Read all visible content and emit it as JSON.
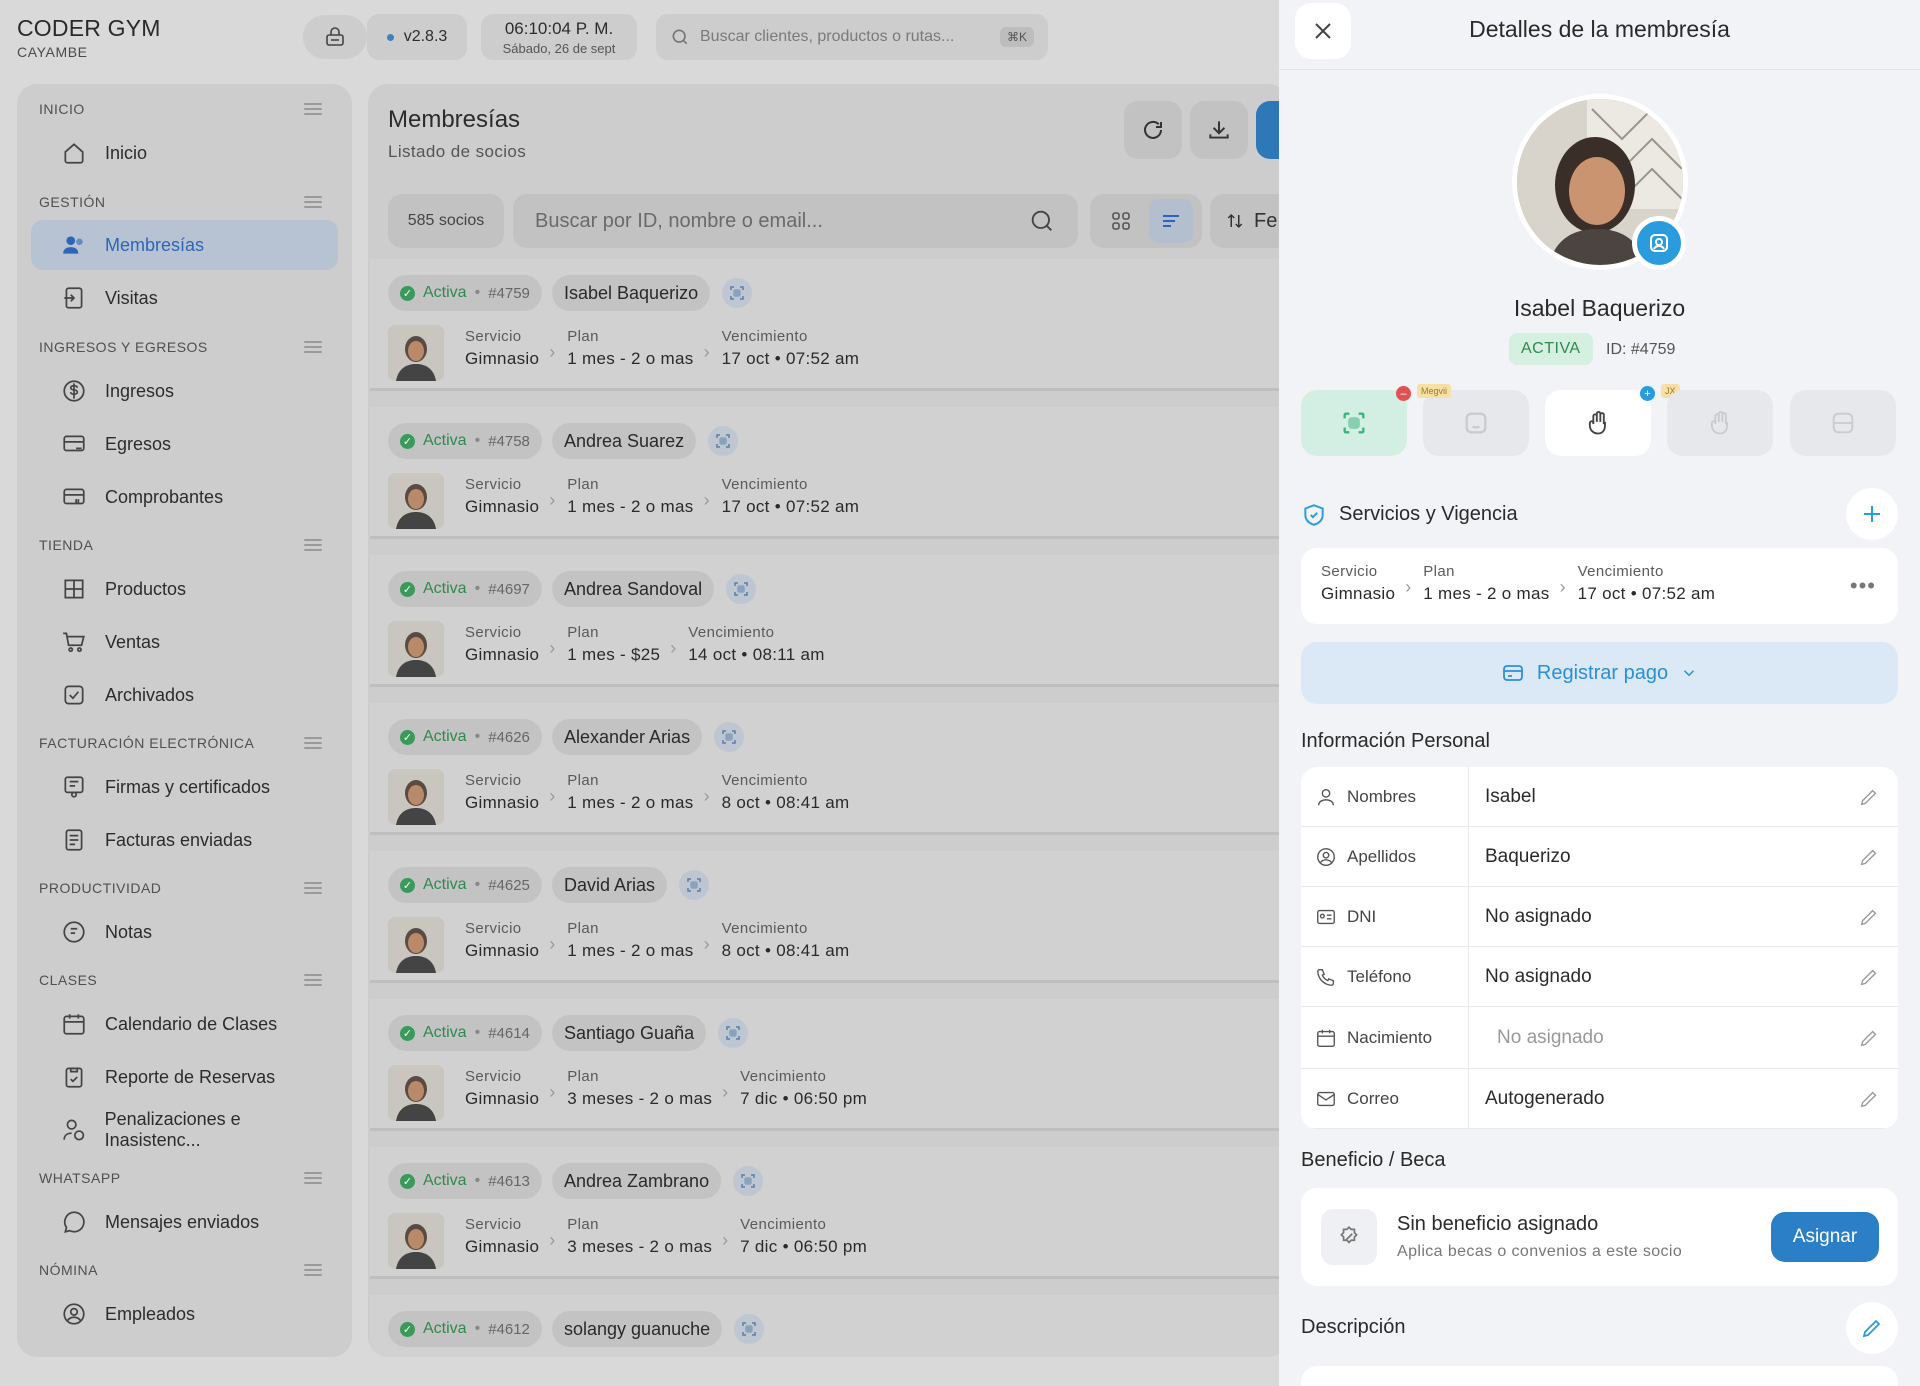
{
  "brand": {
    "title": "CODER GYM",
    "subtitle": "CAYAMBE"
  },
  "topbar": {
    "version": "v2.8.3",
    "time": "06:10:04 P. M.",
    "date": "Sábado, 26 de sept",
    "search_placeholder": "Buscar clientes, productos o rutas...",
    "search_shortcut": "⌘K"
  },
  "sidebar": {
    "sections": [
      {
        "title": "INICIO"
      },
      {
        "title": "GESTIÓN"
      },
      {
        "title": "INGRESOS Y EGRESOS"
      },
      {
        "title": "TIENDA"
      },
      {
        "title": "FACTURACIÓN ELECTRÓNICA"
      },
      {
        "title": "PRODUCTIVIDAD"
      },
      {
        "title": "CLASES"
      },
      {
        "title": "WHATSAPP"
      },
      {
        "title": "NÓMINA"
      }
    ],
    "items": [
      {
        "label": "Inicio",
        "icon": "home-icon"
      },
      {
        "label": "Membresías",
        "icon": "users-icon"
      },
      {
        "label": "Visitas",
        "icon": "login-icon"
      },
      {
        "label": "Ingresos",
        "icon": "dollar-icon"
      },
      {
        "label": "Egresos",
        "icon": "card-out-icon"
      },
      {
        "label": "Comprobantes",
        "icon": "card-receipt-icon"
      },
      {
        "label": "Productos",
        "icon": "store-icon"
      },
      {
        "label": "Ventas",
        "icon": "cart-icon"
      },
      {
        "label": "Archivados",
        "icon": "archive-icon"
      },
      {
        "label": "Firmas y certificados",
        "icon": "certificate-icon"
      },
      {
        "label": "Facturas enviadas",
        "icon": "invoice-icon"
      },
      {
        "label": "Notas",
        "icon": "notes-icon"
      },
      {
        "label": "Calendario de Clases",
        "icon": "calendar-icon"
      },
      {
        "label": "Reporte de Reservas",
        "icon": "clipboard-icon"
      },
      {
        "label": "Penalizaciones e Inasistenc...",
        "icon": "user-penalty-icon"
      },
      {
        "label": "Mensajes enviados",
        "icon": "chat-icon"
      },
      {
        "label": "Empleados",
        "icon": "user-circle-icon"
      }
    ]
  },
  "main": {
    "title": "Membresías",
    "subtitle": "Listado de socios",
    "count": "585 socios",
    "search_placeholder": "Buscar por ID, nombre o email...",
    "sort_label": "Fe",
    "labels": {
      "servicio": "Servicio",
      "plan": "Plan",
      "vencimiento": "Vencimiento"
    },
    "members": [
      {
        "status": "Activa",
        "id": "#4759",
        "name": "Isabel Baquerizo",
        "servicio": "Gimnasio",
        "plan": "1 mes - 2 o mas",
        "vencimiento": "17 oct • 07:52 am"
      },
      {
        "status": "Activa",
        "id": "#4758",
        "name": "Andrea Suarez",
        "servicio": "Gimnasio",
        "plan": "1 mes - 2 o mas",
        "vencimiento": "17 oct • 07:52 am"
      },
      {
        "status": "Activa",
        "id": "#4697",
        "name": "Andrea Sandoval",
        "servicio": "Gimnasio",
        "plan": "1 mes - $25",
        "vencimiento": "14 oct • 08:11 am"
      },
      {
        "status": "Activa",
        "id": "#4626",
        "name": "Alexander Arias",
        "servicio": "Gimnasio",
        "plan": "1 mes - 2 o mas",
        "vencimiento": "8 oct • 08:41 am"
      },
      {
        "status": "Activa",
        "id": "#4625",
        "name": "David Arias",
        "servicio": "Gimnasio",
        "plan": "1 mes - 2 o mas",
        "vencimiento": "8 oct • 08:41 am"
      },
      {
        "status": "Activa",
        "id": "#4614",
        "name": "Santiago Guaña",
        "servicio": "Gimnasio",
        "plan": "3 meses - 2 o mas",
        "vencimiento": "7 dic • 06:50 pm"
      },
      {
        "status": "Activa",
        "id": "#4613",
        "name": "Andrea Zambrano",
        "servicio": "Gimnasio",
        "plan": "3 meses - 2 o mas",
        "vencimiento": "7 dic • 06:50 pm"
      },
      {
        "status": "Activa",
        "id": "#4612",
        "name": "solangy guanuche",
        "servicio": "",
        "plan": "",
        "vencimiento": ""
      }
    ]
  },
  "drawer": {
    "title": "Detalles de la membresía",
    "name": "Isabel Baquerizo",
    "status": "ACTIVA",
    "id_label": "ID: #4759",
    "bio_tags": {
      "megvii": "Megvii",
      "jx": "JX"
    },
    "services_title": "Servicios y Vigencia",
    "service": {
      "servicio": "Gimnasio",
      "plan": "1 mes - 2 o mas",
      "vencimiento": "17 oct • 07:52 am"
    },
    "more": "•••",
    "pay_label": "Registrar pago",
    "info_title": "Información Personal",
    "info": [
      {
        "label": "Nombres",
        "value": "Isabel",
        "icon": "user-icon"
      },
      {
        "label": "Apellidos",
        "value": "Baquerizo",
        "icon": "user-circle-icon"
      },
      {
        "label": "DNI",
        "value": "No asignado",
        "icon": "id-card-icon"
      },
      {
        "label": "Teléfono",
        "value": "No asignado",
        "icon": "phone-icon"
      },
      {
        "label": "Nacimiento",
        "value": "No asignado",
        "icon": "calendar-icon"
      },
      {
        "label": "Correo",
        "value": "Autogenerado",
        "icon": "mail-icon"
      }
    ],
    "benefit_title": "Beneficio / Beca",
    "benefit_heading": "Sin beneficio asignado",
    "benefit_sub": "Aplica becas o convenios a este socio",
    "assign_label": "Asignar",
    "description_title": "Descripción"
  },
  "colors": {
    "accent": "#2a9cde",
    "active_green": "#2f8a4e",
    "nav_active": "#2d66b8"
  }
}
